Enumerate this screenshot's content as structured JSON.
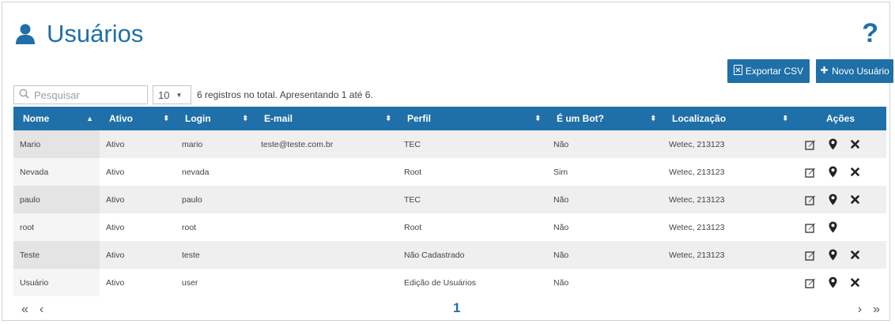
{
  "header": {
    "title": "Usuários",
    "help": "?"
  },
  "toolbar": {
    "export_label": "Exportar CSV",
    "new_label": "Novo Usuário"
  },
  "search": {
    "placeholder": "Pesquisar"
  },
  "page_size": {
    "value": "10"
  },
  "info": "6 registros no total. Apresentando 1 até 6.",
  "table": {
    "columns": [
      "Nome",
      "Ativo",
      "Login",
      "E-mail",
      "Perfil",
      "É um Bot?",
      "Localização",
      "Ações"
    ],
    "rows": [
      {
        "nome": "Mario",
        "ativo": "Ativo",
        "login": "mario",
        "email": "teste@teste.com.br",
        "perfil": "TEC",
        "bot": "Não",
        "loc": "Wetec, 213123",
        "delete": true
      },
      {
        "nome": "Nevada",
        "ativo": "Ativo",
        "login": "nevada",
        "email": "",
        "perfil": "Root",
        "bot": "Sim",
        "loc": "Wetec, 213123",
        "delete": true
      },
      {
        "nome": "paulo",
        "ativo": "Ativo",
        "login": "paulo",
        "email": "",
        "perfil": "TEC",
        "bot": "Não",
        "loc": "Wetec, 213123",
        "delete": true
      },
      {
        "nome": "root",
        "ativo": "Ativo",
        "login": "root",
        "email": "",
        "perfil": "Root",
        "bot": "Não",
        "loc": "Wetec, 213123",
        "delete": false
      },
      {
        "nome": "Teste",
        "ativo": "Ativo",
        "login": "teste",
        "email": "",
        "perfil": "Não Cadastrado",
        "bot": "Não",
        "loc": "Wetec, 213123",
        "delete": true
      },
      {
        "nome": "Usuário",
        "ativo": "Ativo",
        "login": "user",
        "email": "",
        "perfil": "Edição de Usuários",
        "bot": "Não",
        "loc": "",
        "delete": true
      }
    ]
  },
  "pager": {
    "first": "«",
    "prev": "‹",
    "current": "1",
    "next": "›",
    "last": "»"
  },
  "colors": {
    "accent": "#1f6fa8"
  },
  "icons": [
    "user-icon",
    "help-icon",
    "csv-file-icon",
    "plus-icon",
    "search-icon",
    "sort-asc-icon",
    "sort-icon",
    "edit-icon",
    "location-pin-icon",
    "delete-icon"
  ]
}
